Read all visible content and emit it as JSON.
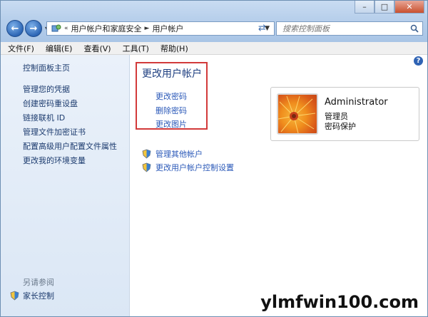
{
  "nav": {
    "breadcrumb": [
      "用户帐户和家庭安全",
      "用户帐户"
    ],
    "search_placeholder": "搜索控制面板"
  },
  "menu": [
    "文件(F)",
    "编辑(E)",
    "查看(V)",
    "工具(T)",
    "帮助(H)"
  ],
  "sidebar": {
    "home": "控制面板主页",
    "links": [
      "管理您的凭据",
      "创建密码重设盘",
      "链接联机 ID",
      "管理文件加密证书",
      "配置高级用户配置文件属性",
      "更改我的环境变量"
    ],
    "see_also": "另请参阅",
    "family_safety": "家长控制"
  },
  "main": {
    "heading": "更改用户帐户",
    "tasks": [
      "更改密码",
      "删除密码",
      "更改图片"
    ],
    "other_links": [
      "管理其他帐户",
      "更改用户帐户控制设置"
    ]
  },
  "account": {
    "name": "Administrator",
    "role": "管理员",
    "status": "密码保护"
  },
  "watermark": "ylmfwin100.com",
  "colors": {
    "highlight_box": "#d23a3a",
    "link": "#2a58b8",
    "heading": "#1e3f80"
  }
}
